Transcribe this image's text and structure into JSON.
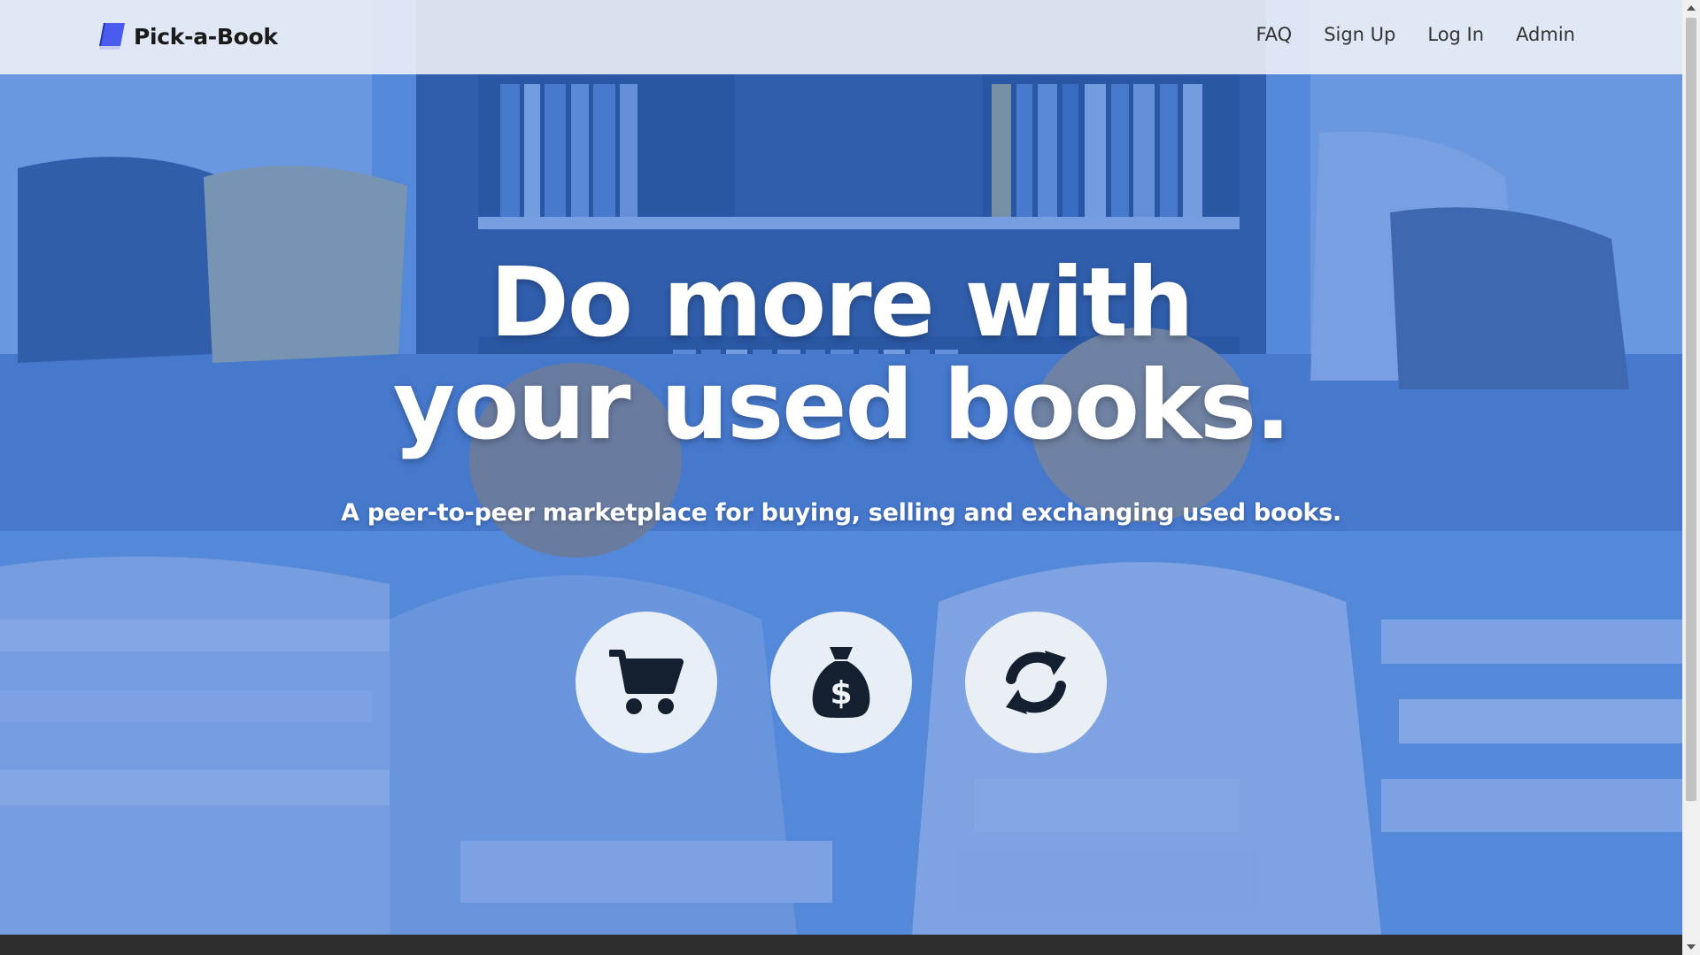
{
  "navbar": {
    "brand": "Pick-a-Book",
    "links": [
      "FAQ",
      "Sign Up",
      "Log In",
      "Admin"
    ]
  },
  "hero": {
    "headline_line1": "Do more with",
    "headline_line2": "your used books.",
    "subtitle": "A peer-to-peer marketplace for buying, selling and exchanging used books."
  },
  "actions": [
    {
      "icon": "shopping-cart-icon"
    },
    {
      "icon": "money-bag-icon"
    },
    {
      "icon": "exchange-arrows-icon"
    }
  ],
  "colors": {
    "overlay": "#346fd6",
    "brand_icon": "#3b52e0",
    "icon_dark": "#142030",
    "footer": "#2d2d2d"
  }
}
